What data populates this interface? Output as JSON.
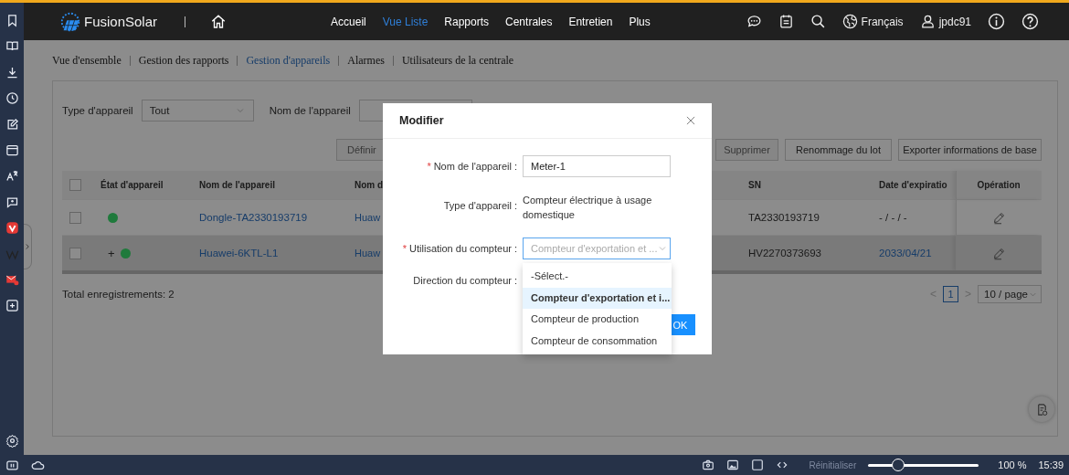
{
  "header": {
    "logo": "FusionSolar",
    "nav": [
      {
        "label": "Accueil",
        "selected": false
      },
      {
        "label": "Vue Liste",
        "selected": true
      },
      {
        "label": "Rapports",
        "selected": false
      },
      {
        "label": "Centrales",
        "selected": false
      },
      {
        "label": "Entretien",
        "selected": false
      },
      {
        "label": "Plus",
        "selected": false
      }
    ],
    "language": "Français",
    "user": "jpdc91"
  },
  "subnav": [
    {
      "label": "Vue d'ensemble",
      "selected": false
    },
    {
      "label": "Gestion des rapports",
      "selected": false
    },
    {
      "label": "Gestion d'appareils",
      "selected": true
    },
    {
      "label": "Alarmes",
      "selected": false
    },
    {
      "label": "Utilisateurs de la centrale",
      "selected": false
    }
  ],
  "filters": [
    {
      "label": "Type d'appareil",
      "kind": "select",
      "value": "Tout"
    },
    {
      "label": "Nom de l'appareil",
      "kind": "input"
    }
  ],
  "toolbar": [
    {
      "label": "Définir",
      "disabled": true
    },
    {
      "label": "Supprimer",
      "disabled": true
    },
    {
      "label": "Renommage du lot",
      "disabled": false
    },
    {
      "label": "Exporter informations de base",
      "disabled": false
    }
  ],
  "table": {
    "header_checked": false,
    "columns": [
      "État d'appareil",
      "Nom de l'appareil",
      "Nom d",
      "SN",
      "Date d'expiratio",
      "Opération"
    ],
    "rows": [
      {
        "checked": false,
        "highlighted": false,
        "color": "#1f7a3c",
        "name": "Dongle-TA2330193719",
        "column_3": "Huaw",
        "sn": "TA2330193719",
        "expiry": "- / - / -",
        "expiry_link": false
      },
      {
        "checked": false,
        "expander": "+",
        "highlighted": true,
        "color": "#1f7a3c",
        "name": "Huawei-6KTL-L1",
        "column_3": "Huaw",
        "sn": "HV2270373693",
        "expiry": "2033/04/21",
        "expiry_link": true
      }
    ]
  },
  "total": "Total enregistrements: 2",
  "pagination": {
    "prev": "<",
    "next": ">",
    "pages": [
      {
        "label": "1",
        "selected": true
      }
    ],
    "page_size": "10 / page"
  },
  "modal": {
    "title": "Modifier",
    "fields": [
      {
        "label": "Nom de l'appareil",
        "separator": ":",
        "required_mark": "*",
        "kind": "input",
        "value": "Meter-1"
      },
      {
        "label": "Type d'appareil",
        "separator": ":",
        "kind": "text",
        "value": "Compteur électrique à usage domestique"
      },
      {
        "label": "Utilisation du compteur",
        "separator": ":",
        "required_mark": "*",
        "kind": "select",
        "value": "Compteur d'exportation et ...",
        "open": true,
        "options": [
          {
            "label": "-Sélect.-",
            "selected": false
          },
          {
            "label": "Compteur d'exportation et i...",
            "selected": true
          },
          {
            "label": "Compteur de production",
            "selected": false
          },
          {
            "label": "Compteur de consommation",
            "selected": false
          }
        ]
      },
      {
        "label": "Direction du compteur",
        "separator": ":",
        "kind": "empty"
      }
    ],
    "ok": "OK"
  },
  "status_bar": {
    "reset": "Réinitialiser",
    "zoom": {
      "level": 0.27
    },
    "zoom_text": "100 %",
    "time": "15:39"
  }
}
